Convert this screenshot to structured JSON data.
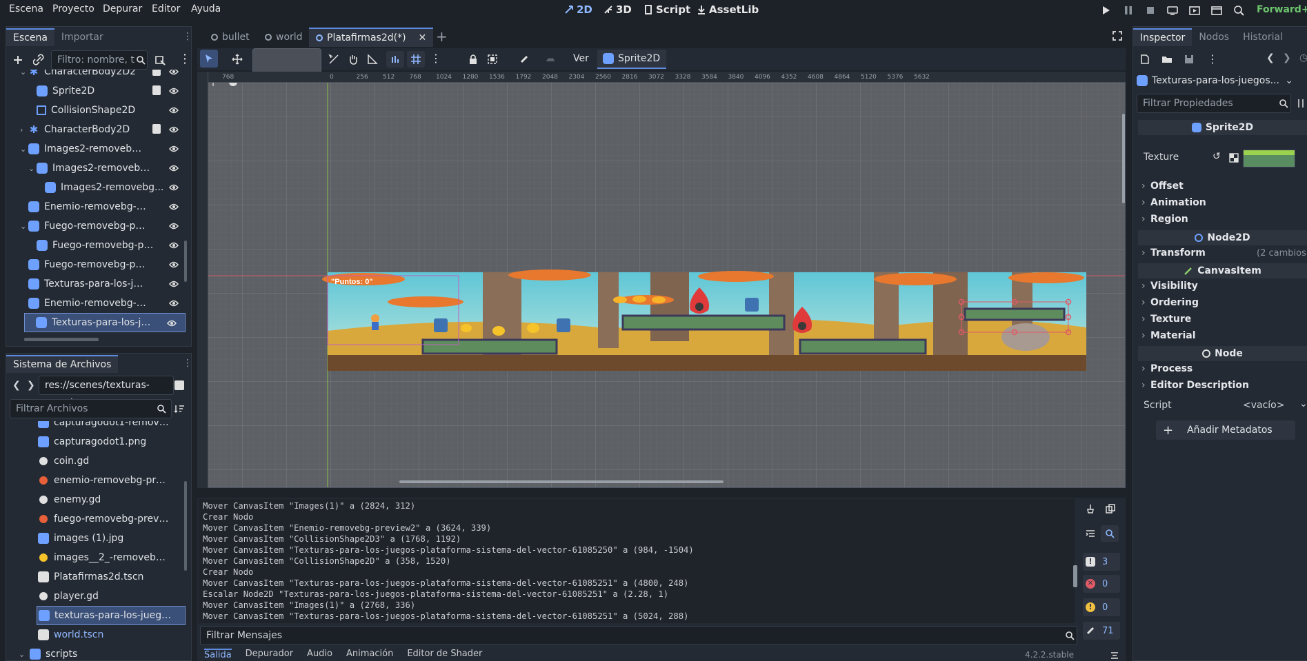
{
  "menu": [
    "Escena",
    "Proyecto",
    "Depurar",
    "Editor",
    "Ayuda"
  ],
  "modes": {
    "m2d": "2D",
    "m3d": "3D",
    "script": "Script",
    "assetlib": "AssetLib"
  },
  "renderer": "Forward+",
  "scene_panel": {
    "tabs": [
      "Escena",
      "Importar"
    ],
    "filter_placeholder": "Filtro: nombre, t",
    "nodes": [
      {
        "label": "CharacterBody2D2",
        "indent": 0,
        "icon": "char",
        "arrow": "open"
      },
      {
        "label": "Sprite2D",
        "indent": 1,
        "icon": "sprite",
        "arrow": ""
      },
      {
        "label": "CollisionShape2D",
        "indent": 1,
        "icon": "coll",
        "arrow": ""
      },
      {
        "label": "CharacterBody2D",
        "indent": 0,
        "icon": "char",
        "arrow": "closed"
      },
      {
        "label": "Images2-removebg-pre...",
        "indent": 0,
        "icon": "sprite",
        "arrow": "open"
      },
      {
        "label": "Images2-removebg-p...",
        "indent": 1,
        "icon": "sprite",
        "arrow": "open"
      },
      {
        "label": "Images2-removebg...",
        "indent": 2,
        "icon": "sprite",
        "arrow": ""
      },
      {
        "label": "Enemio-removebg-prev...",
        "indent": 0,
        "icon": "sprite",
        "arrow": ""
      },
      {
        "label": "Fuego-removebg-previ...",
        "indent": 0,
        "icon": "sprite",
        "arrow": "open"
      },
      {
        "label": "Fuego-removebg-pre...",
        "indent": 1,
        "icon": "sprite",
        "arrow": ""
      },
      {
        "label": "Fuego-removebg-previ...",
        "indent": 0,
        "icon": "sprite",
        "arrow": ""
      },
      {
        "label": "Texturas-para-los-juego...",
        "indent": 0,
        "icon": "sprite",
        "arrow": ""
      },
      {
        "label": "Enemio-removebg-prev...",
        "indent": 0,
        "icon": "sprite",
        "arrow": ""
      },
      {
        "label": "Texturas-para-los-juego...",
        "indent": 0,
        "icon": "sprite",
        "arrow": "",
        "selected": true
      }
    ]
  },
  "filesystem": {
    "title": "Sistema de Archivos",
    "path": "res://scenes/texturas-para-l",
    "filter_placeholder": "Filtrar Archivos",
    "files": [
      {
        "label": "capturagodot1-removeb...",
        "icon": "img"
      },
      {
        "label": "capturagodot1.png",
        "icon": "img"
      },
      {
        "label": "coin.gd",
        "icon": "gear"
      },
      {
        "label": "enemio-removebg-previe...",
        "icon": "fire"
      },
      {
        "label": "enemy.gd",
        "icon": "gear"
      },
      {
        "label": "fuego-removebg-preview...",
        "icon": "fire"
      },
      {
        "label": "images (1).jpg",
        "icon": "img"
      },
      {
        "label": "images__2_-removebg-pr...",
        "icon": "coin"
      },
      {
        "label": "Platafirmas2d.tscn",
        "icon": "scene"
      },
      {
        "label": "player.gd",
        "icon": "gear"
      },
      {
        "label": "texturas-para-los-juegos-...",
        "icon": "img",
        "selected": true
      },
      {
        "label": "world.tscn",
        "icon": "scene",
        "link": true
      },
      {
        "label": "scripts",
        "icon": "folder",
        "folder": true
      }
    ]
  },
  "editor_tabs": [
    {
      "label": "bullet",
      "active": false
    },
    {
      "label": "world",
      "active": false
    },
    {
      "label": "Platafirmas2d(*)",
      "active": true
    }
  ],
  "toolbar": {
    "view_label": "Ver",
    "node_label": "Sprite2D"
  },
  "ruler_ticks": [
    "768",
    "0",
    "256",
    "512",
    "768",
    "1024",
    "1280",
    "1536",
    "1792",
    "2048",
    "2304",
    "2560",
    "2816",
    "3072",
    "3328",
    "3584",
    "3840",
    "4096",
    "4352",
    "4608",
    "4864",
    "5120",
    "5376",
    "5632"
  ],
  "canvas": {
    "score_label": "\"Puntos: 0\""
  },
  "output": {
    "lines": [
      "Mover CanvasItem \"Images(1)\" a (2824, 312)",
      "Crear Nodo",
      "Mover CanvasItem \"Enemio-removebg-preview2\" a (3624, 339)",
      "Mover CanvasItem \"CollisionShape2D3\" a (1768, 1192)",
      "Mover CanvasItem \"Texturas-para-los-juegos-plataforma-sistema-del-vector-61085250\" a (984, -1504)",
      "Mover CanvasItem \"CollisionShape2D\" a (358, 1520)",
      "Crear Nodo",
      "Mover CanvasItem \"Texturas-para-los-juegos-plataforma-sistema-del-vector-61085251\" a (4800, 248)",
      "Escalar Node2D \"Texturas-para-los-juegos-plataforma-sistema-del-vector-61085251\" a (2.28, 1)",
      "Mover CanvasItem \"Images(1)\" a (2768, 336)",
      "Mover CanvasItem \"Texturas-para-los-juegos-plataforma-sistema-del-vector-61085251\" a (5024, 288)"
    ],
    "filter_placeholder": "Filtrar Mensajes",
    "counts": {
      "messages": "3",
      "errors": "0",
      "warnings": "0",
      "editor": "71"
    },
    "bottom_tabs": [
      "Salida",
      "Depurador",
      "Audio",
      "Animación",
      "Editor de Shader"
    ],
    "version": "4.2.2.stable"
  },
  "inspector": {
    "tabs": [
      "Inspector",
      "Nodos",
      "Historial"
    ],
    "resource": "Texturas-para-los-juegos...",
    "filter_placeholder": "Filtrar Propiedades",
    "class_sprite": "Sprite2D",
    "texture_label": "Texture",
    "sprite_sections": [
      "Offset",
      "Animation",
      "Region"
    ],
    "class_node2d": "Node2D",
    "transform_label": "Transform",
    "transform_note": "(2 cambios",
    "class_canvasitem": "CanvasItem",
    "canvas_sections": [
      "Visibility",
      "Ordering",
      "Texture",
      "Material"
    ],
    "class_node": "Node",
    "node_sections": [
      "Process",
      "Editor Description"
    ],
    "script_label": "Script",
    "script_value": "<vacío>",
    "add_metadata": "Añadir Metadatos"
  },
  "colors": {
    "accent": "#5f8ce0",
    "background": "#1d2229",
    "panel": "#242a33",
    "selection": "#3b5078",
    "node_icon": "#6ea0ff"
  }
}
